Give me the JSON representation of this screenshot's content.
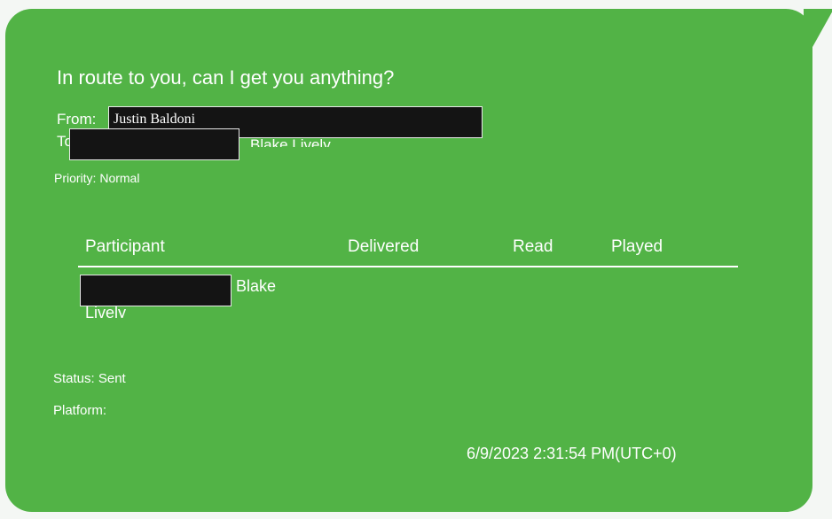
{
  "message": {
    "subject": "In route to you, can I get you anything?",
    "from_label": "From:",
    "from_name": "Justin Baldoni",
    "to_label": "To",
    "to_name": "Blake Lively",
    "priority_text": "Priority: Normal"
  },
  "participants_table": {
    "headers": [
      "Participant",
      "Delivered",
      "Read",
      "Played"
    ],
    "rows": [
      {
        "first_line": "Blake",
        "second_line": "Lively"
      }
    ]
  },
  "status_text": "Status: Sent",
  "platform_text": "Platform:",
  "timestamp": "6/9/2023 2:31:54 PM(UTC+0)",
  "colors": {
    "bubble": "#52b346",
    "redaction": "#141414",
    "text": "#ffffff"
  }
}
